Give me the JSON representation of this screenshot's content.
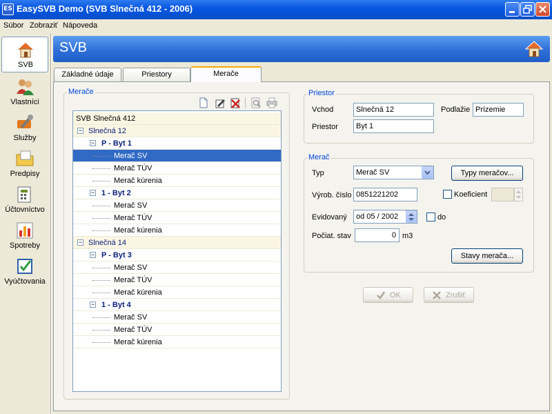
{
  "window": {
    "title": "EasySVB Demo  (SVB Slnečná 412 - 2006)",
    "app_icon": "ES"
  },
  "menu": {
    "items": [
      "Súbor",
      "Zobraziť",
      "Nápoveda"
    ]
  },
  "sidebar": {
    "items": [
      {
        "label": "SVB",
        "icon": "home-icon",
        "active": true
      },
      {
        "label": "Vlastníci",
        "icon": "owners-icon"
      },
      {
        "label": "Služby",
        "icon": "services-icon"
      },
      {
        "label": "Predpisy",
        "icon": "prescriptions-icon"
      },
      {
        "label": "Účtovníctvo",
        "icon": "accounting-icon"
      },
      {
        "label": "Spotreby",
        "icon": "consumption-chart-icon"
      },
      {
        "label": "Vyúčtovania",
        "icon": "billing-icon"
      }
    ]
  },
  "header": {
    "title": "SVB"
  },
  "tabs": [
    "Základné údaje",
    "Priestory",
    "Merače"
  ],
  "meters_group": {
    "label": "Merače"
  },
  "tree": [
    {
      "text": "SVB Slnečná 412",
      "level": 0
    },
    {
      "text": "Slnečná 12",
      "level": 1
    },
    {
      "text": "P - Byt 1",
      "level": 2
    },
    {
      "text": "Merač SV",
      "level": 3,
      "selected": true
    },
    {
      "text": "Merač TÚV",
      "level": 3
    },
    {
      "text": "Merač kúrenia",
      "level": 3
    },
    {
      "text": "1 - Byt 2",
      "level": 2
    },
    {
      "text": "Merač SV",
      "level": 3
    },
    {
      "text": "Merač TÚV",
      "level": 3
    },
    {
      "text": "Merač kúrenia",
      "level": 3
    },
    {
      "text": "Slnečná 14",
      "level": 1
    },
    {
      "text": "P - Byt 3",
      "level": 2
    },
    {
      "text": "Merač SV",
      "level": 3
    },
    {
      "text": "Merač TÚV",
      "level": 3
    },
    {
      "text": "Merač kúrenia",
      "level": 3
    },
    {
      "text": "1 - Byt 4",
      "level": 2
    },
    {
      "text": "Merač SV",
      "level": 3
    },
    {
      "text": "Merač TÚV",
      "level": 3
    },
    {
      "text": "Merač kúrenia",
      "level": 3
    }
  ],
  "priestor": {
    "label": "Priestor",
    "vchod_label": "Vchod",
    "vchod_value": "Slnečná 12",
    "podlazie_label": "Podlažie",
    "podlazie_value": "Prízemie",
    "priestor_label": "Priestor",
    "priestor_value": "Byt 1"
  },
  "merac": {
    "label": "Merač",
    "typ_label": "Typ",
    "typ_value": "Merač SV",
    "typy_button": "Typy meračov...",
    "vyrob_label": "Výrob. číslo",
    "vyrob_value": "0851221202",
    "koeficient_label": "Koeficient",
    "koeficient_value": "",
    "evid_label": "Evidovaný",
    "evid_value": "od 05 / 2002",
    "do_label": "do",
    "pociat_label": "Počiat. stav",
    "pociat_value": "0",
    "pociat_unit": "m3",
    "stavy_button": "Stavy merača..."
  },
  "actions": {
    "ok": "OK",
    "cancel": "Zrušiť"
  }
}
